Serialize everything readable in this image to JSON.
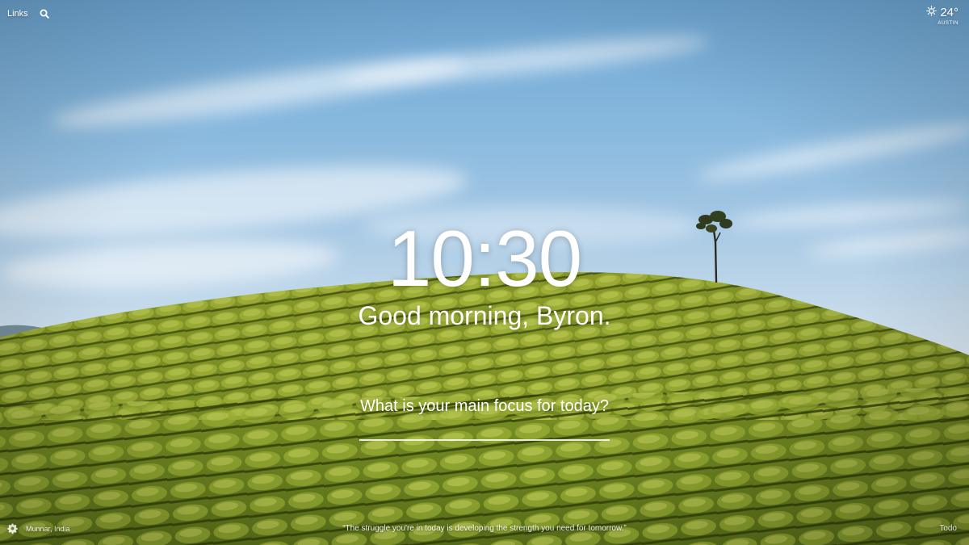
{
  "top_bar": {
    "links_label": "Links",
    "search_icon": "search-icon"
  },
  "weather": {
    "icon": "sun-icon",
    "temperature": "24°",
    "location": "AUSTIN"
  },
  "main": {
    "time": "10:30",
    "greeting": "Good morning, Byron.",
    "focus_question": "What is your main focus for today?",
    "focus_value": ""
  },
  "footer": {
    "settings_icon": "gear-icon",
    "photo_location": "Munnar, India",
    "quote": "“The struggle you're in today is developing the strength you need for tomorrow.”",
    "todo_label": "Todo"
  },
  "colors": {
    "sky_top": "#6ea6d3",
    "sky_horizon": "#dfe8ef",
    "hill_light": "#a3b43a",
    "hill_dark": "#4d5e14",
    "text": "#ffffff"
  }
}
